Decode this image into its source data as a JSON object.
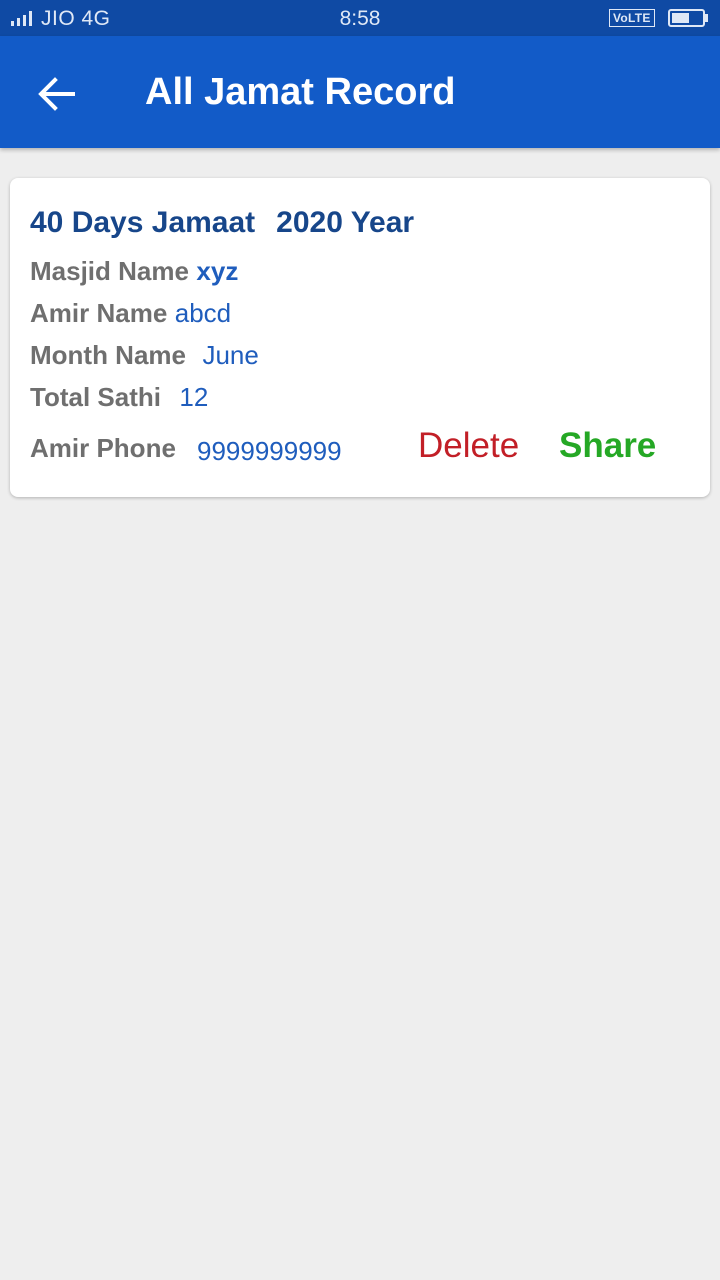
{
  "status_bar": {
    "carrier": "JIO 4G",
    "time": "8:58",
    "volte": "VoLTE",
    "icons": [
      "signal-icon",
      "battery-icon"
    ]
  },
  "app_bar": {
    "title": "All Jamat Record",
    "back_icon": "arrow-left-icon"
  },
  "record": {
    "duration": "40 Days Jamaat",
    "year": "2020 Year",
    "masjid_label": "Masjid Name",
    "masjid_value": "xyz",
    "amir_label": "Amir Name",
    "amir_value": "abcd",
    "month_label": "Month Name",
    "month_value": "June",
    "sathi_label": "Total Sathi",
    "sathi_value": "12",
    "phone_label": "Amir Phone",
    "phone_value": "9999999999",
    "delete_label": "Delete",
    "share_label": "Share"
  },
  "colors": {
    "status_bar": "#0f4aa4",
    "app_bar": "#125bc8",
    "background": "#eeeeee",
    "heading": "#17468a",
    "label": "#6f6f6f",
    "value": "#1f5dbd",
    "delete": "#c21f27",
    "share": "#25a825"
  }
}
